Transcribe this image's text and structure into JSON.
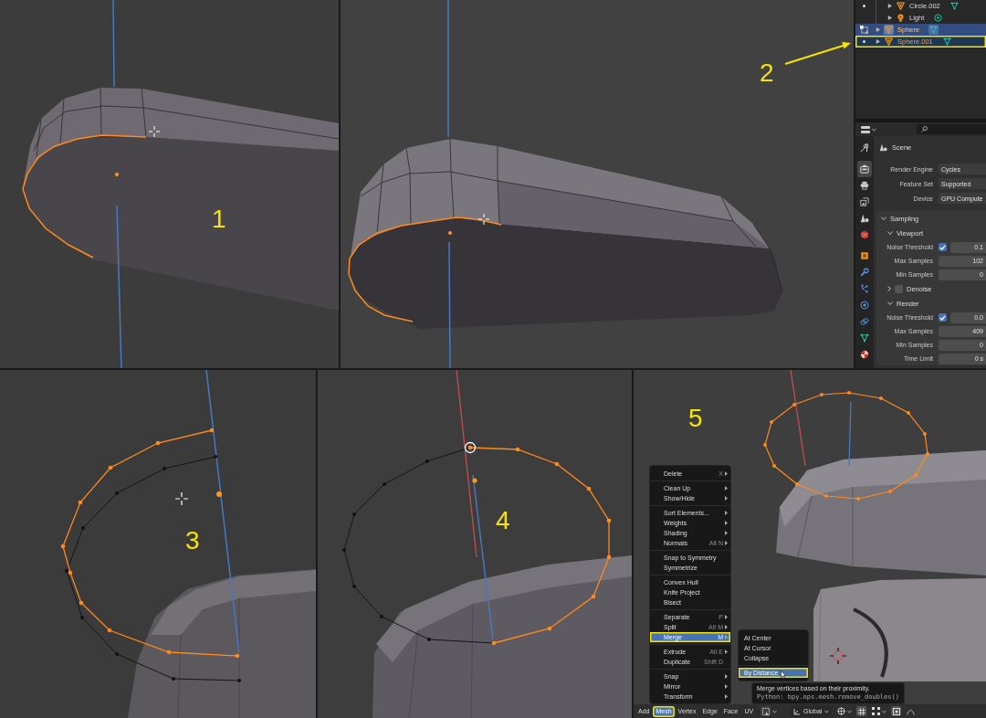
{
  "view_top_left": {
    "label": "1"
  },
  "view_top_right": {
    "label": "2"
  },
  "outliner": {
    "items": [
      {
        "children": [
          {
            "name": "Circle.002",
            "kind": "mesh",
            "editing": false,
            "expanded": false,
            "selected": false,
            "active": false,
            "annotated": false
          },
          {
            "name": "Light",
            "kind": "light",
            "expanded": false,
            "selected": false,
            "active": false,
            "annotated": false
          }
        ]
      },
      {
        "name": "Sphere",
        "kind": "mesh",
        "editing": true,
        "expanded": false,
        "selected": true,
        "active": true,
        "annotated": false
      },
      {
        "name": "Sphere.001",
        "kind": "mesh",
        "editing": false,
        "expanded": false,
        "selected": true,
        "active": false,
        "annotated": true
      }
    ]
  },
  "properties": {
    "tabs": [
      {
        "kind": "tool",
        "selected": false
      },
      {
        "kind": "render",
        "selected": true
      },
      {
        "kind": "output",
        "selected": false
      },
      {
        "kind": "view_layer",
        "selected": false
      },
      {
        "kind": "scene",
        "selected": false
      },
      {
        "kind": "world",
        "selected": false
      },
      {
        "kind": "object",
        "selected": false
      },
      {
        "kind": "modifier",
        "selected": false
      },
      {
        "kind": "particles",
        "selected": false
      },
      {
        "kind": "physics",
        "selected": false
      },
      {
        "kind": "constraints",
        "selected": false
      },
      {
        "kind": "data",
        "selected": false
      },
      {
        "kind": "material",
        "selected": false
      }
    ],
    "breadcrumb": "Scene",
    "fields": [
      {
        "label": "Render Engine",
        "value": "Cycles"
      },
      {
        "label": "Feature Set",
        "value": "Supported"
      },
      {
        "label": "Device",
        "value": "GPU Compute"
      }
    ],
    "sections": [
      {
        "title": "Sampling",
        "expanded": true,
        "subsections": [
          {
            "title": "Viewport",
            "kind": "plain",
            "expanded": true,
            "rows": [
              {
                "kind": "toggle",
                "label": "Noise Threshold",
                "checked": true,
                "value": "0.1"
              },
              {
                "kind": "number",
                "label": "Max Samples",
                "value": "102"
              },
              {
                "kind": "number",
                "label": "Min Samples",
                "value": "0"
              }
            ]
          },
          {
            "title": "Denoise",
            "kind": "toggle",
            "checked": false,
            "expanded": false
          },
          {
            "title": "Render",
            "kind": "plain",
            "expanded": true,
            "rows": [
              {
                "kind": "toggle",
                "label": "Noise Threshold",
                "checked": true,
                "value": "0.0"
              },
              {
                "kind": "number",
                "label": "Max Samples",
                "value": "409"
              },
              {
                "kind": "number",
                "label": "Min Samples",
                "value": "0"
              },
              {
                "kind": "number",
                "label": "Time Limit",
                "value": "0 s"
              }
            ]
          }
        ]
      }
    ]
  },
  "view_bottom_left": {
    "label": "3"
  },
  "view_bottom_middle": {
    "label": "4"
  },
  "view_bottom_right": {
    "label": "5",
    "mesh_menu": {
      "groups": [
        [
          {
            "label": "Delete",
            "shortcut": "X",
            "submenu": true,
            "selected": false,
            "annotated": false
          }
        ],
        [
          {
            "label": "Clean Up",
            "submenu": true,
            "selected": false,
            "annotated": false
          },
          {
            "label": "Show/Hide",
            "submenu": true,
            "selected": false,
            "annotated": false
          }
        ],
        [
          {
            "label": "Sort Elements...",
            "submenu": true,
            "selected": false,
            "annotated": false
          },
          {
            "label": "Weights",
            "submenu": true,
            "selected": false,
            "annotated": false
          },
          {
            "label": "Shading",
            "submenu": true,
            "selected": false,
            "annotated": false
          },
          {
            "label": "Normals",
            "shortcut": "Alt N",
            "submenu": true,
            "selected": false,
            "annotated": false
          }
        ],
        [
          {
            "label": "Snap to Symmetry",
            "submenu": false,
            "selected": false,
            "annotated": false
          },
          {
            "label": "Symmetrize",
            "submenu": false,
            "selected": false,
            "annotated": false
          }
        ],
        [
          {
            "label": "Convex Hull",
            "submenu": false,
            "selected": false,
            "annotated": false
          },
          {
            "label": "Knife Project",
            "submenu": false,
            "selected": false,
            "annotated": false
          },
          {
            "label": "Bisect",
            "submenu": false,
            "selected": false,
            "annotated": false
          }
        ],
        [
          {
            "label": "Separate",
            "shortcut": "P",
            "submenu": true,
            "selected": false,
            "annotated": false
          },
          {
            "label": "Split",
            "shortcut": "Alt M",
            "submenu": true,
            "selected": false,
            "annotated": false
          },
          {
            "label": "Merge",
            "shortcut": "M",
            "submenu": true,
            "selected": true,
            "annotated": true
          }
        ],
        [
          {
            "label": "Extrude",
            "shortcut": "Alt E",
            "submenu": true,
            "selected": false,
            "annotated": false
          },
          {
            "label": "Duplicate",
            "shortcut": "Shift D",
            "submenu": false,
            "selected": false,
            "annotated": false
          }
        ],
        [
          {
            "label": "Snap",
            "submenu": true,
            "selected": false,
            "annotated": false
          },
          {
            "label": "Mirror",
            "submenu": true,
            "selected": false,
            "annotated": false
          },
          {
            "label": "Transform",
            "submenu": true,
            "selected": false,
            "annotated": false
          }
        ]
      ]
    },
    "merge_submenu": {
      "groups": [
        [
          {
            "label": "At Center",
            "selected": false,
            "annotated": false
          },
          {
            "label": "At Cursor",
            "selected": false,
            "annotated": false
          },
          {
            "label": "Collapse",
            "selected": false,
            "annotated": false
          }
        ],
        [
          {
            "label": "By Distance",
            "selected": true,
            "annotated": true
          }
        ]
      ]
    },
    "tooltip": {
      "description": "Merge vertices based on their proximity.",
      "python": "Python: bpy.ops.mesh.remove_doubles()"
    },
    "header": {
      "menus": [
        {
          "label": "Add",
          "selected": false,
          "annotated": false
        },
        {
          "label": "Mesh",
          "selected": true,
          "annotated": true
        },
        {
          "label": "Vertex",
          "selected": false,
          "annotated": false
        },
        {
          "label": "Edge",
          "selected": false,
          "annotated": false
        },
        {
          "label": "Face",
          "selected": false,
          "annotated": false
        },
        {
          "label": "UV",
          "selected": false,
          "annotated": false
        }
      ],
      "orientation": "Global"
    }
  }
}
